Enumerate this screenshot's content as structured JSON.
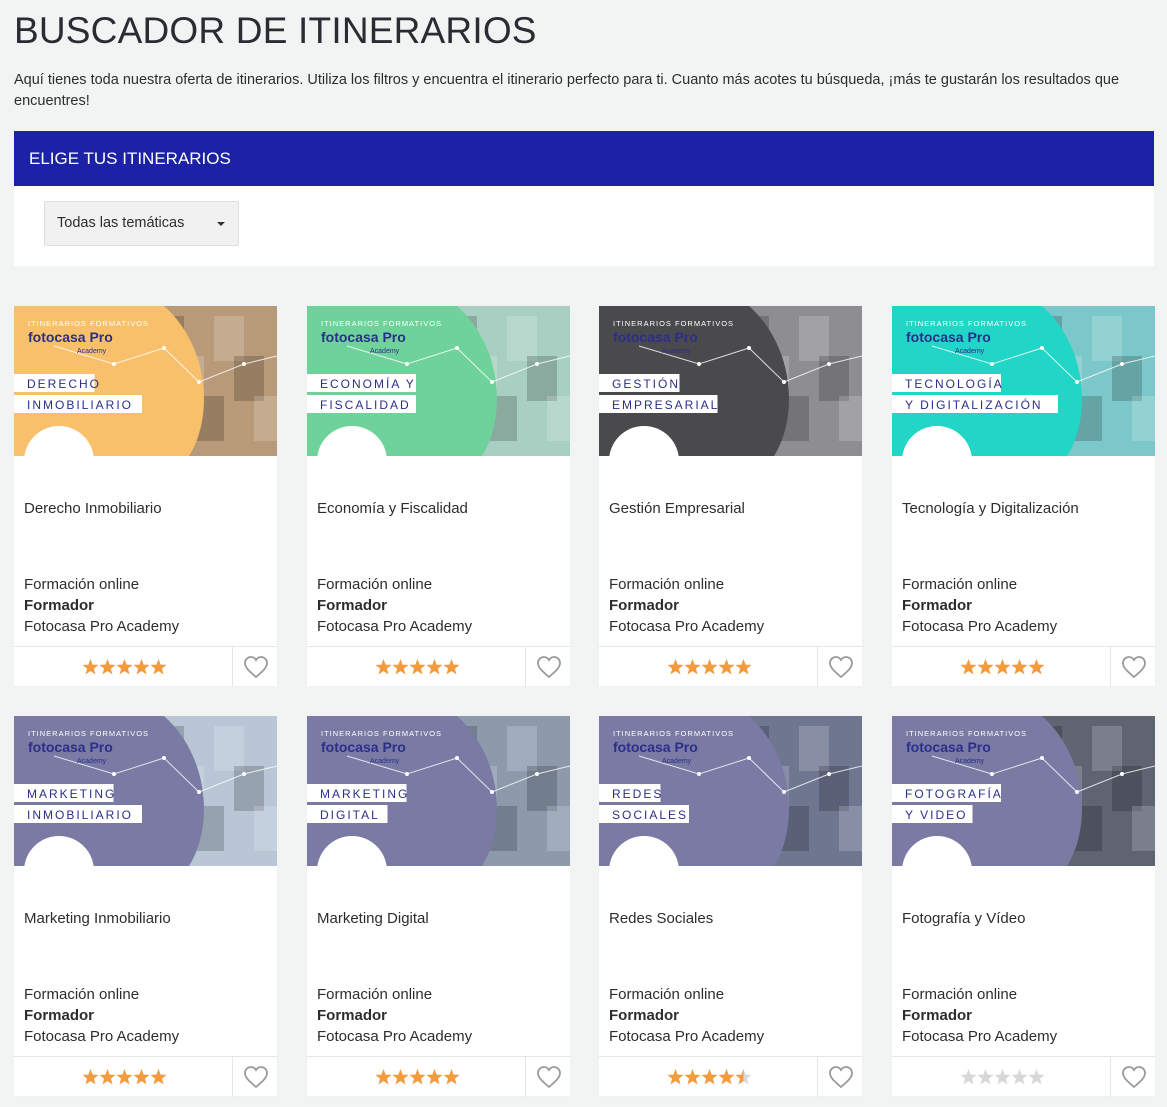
{
  "page": {
    "title": "BUSCADOR DE ITINERARIOS",
    "intro": "Aquí tienes toda nuestra oferta de itinerarios. Utiliza los filtros y encuentra el itinerario perfecto para ti. Cuanto más acotes tu búsqueda, ¡más te gustarán los resultados que encuentres!"
  },
  "filter": {
    "header": "ELIGE TUS ITINERARIOS",
    "select_value": "Todas las temáticas"
  },
  "banner_common": {
    "kicker": "ITINERARIOS FORMATIVOS",
    "brand": "fotocasa Pro",
    "brand_sub": "Academy"
  },
  "colors": {
    "accent_blue": "#1c22a6",
    "star_filled": "#f29b3f",
    "star_empty": "#d8d8d8"
  },
  "cards": [
    {
      "title": "Derecho Inmobiliario",
      "label1": "DERECHO",
      "label2": "INMOBILIARIO",
      "mode": "Formación online",
      "trainer_label": "Formador",
      "trainer": "Fotocasa Pro Academy",
      "rating": 5,
      "color": "#f9c06b",
      "photo": "#b99a78"
    },
    {
      "title": "Economía y Fiscalidad",
      "label1": "ECONOMÍA Y",
      "label2": "FISCALIDAD",
      "mode": "Formación online",
      "trainer_label": "Formador",
      "trainer": "Fotocasa Pro Academy",
      "rating": 5,
      "color": "#6fd29a",
      "photo": "#a9cfc3"
    },
    {
      "title": "Gestión Empresarial",
      "label1": "GESTIÓN",
      "label2": "EMPRESARIAL",
      "mode": "Formación online",
      "trainer_label": "Formador",
      "trainer": "Fotocasa Pro Academy",
      "rating": 5,
      "color": "#4a4a4c",
      "photo": "#8e8e92"
    },
    {
      "title": "Tecnología y Digitalización",
      "label1": "TECNOLOGÍA",
      "label2": "Y DIGITALIZACIÓN",
      "mode": "Formación online",
      "trainer_label": "Formador",
      "trainer": "Fotocasa Pro Academy",
      "rating": 5,
      "color": "#21d6c6",
      "photo": "#7cc7c9"
    },
    {
      "title": "Marketing Inmobiliario",
      "label1": "MARKETING",
      "label2": "INMOBILIARIO",
      "mode": "Formación online",
      "trainer_label": "Formador",
      "trainer": "Fotocasa Pro Academy",
      "rating": 5,
      "color": "#7a7aa4",
      "photo": "#b8c6d6"
    },
    {
      "title": "Marketing Digital",
      "label1": "MARKETING",
      "label2": "DIGITAL",
      "mode": "Formación online",
      "trainer_label": "Formador",
      "trainer": "Fotocasa Pro Academy",
      "rating": 5,
      "color": "#7a7aa4",
      "photo": "#8c9aac"
    },
    {
      "title": "Redes Sociales",
      "label1": "REDES",
      "label2": "SOCIALES",
      "mode": "Formación online",
      "trainer_label": "Formador",
      "trainer": "Fotocasa Pro Academy",
      "rating": 4.5,
      "color": "#7a7aa4",
      "photo": "#6e7690"
    },
    {
      "title": "Fotografía y Vídeo",
      "label1": "FOTOGRAFÍA",
      "label2": "Y VIDEO",
      "mode": "Formación online",
      "trainer_label": "Formador",
      "trainer": "Fotocasa Pro Academy",
      "rating": 0,
      "color": "#7a7aa4",
      "photo": "#5f6372"
    }
  ]
}
